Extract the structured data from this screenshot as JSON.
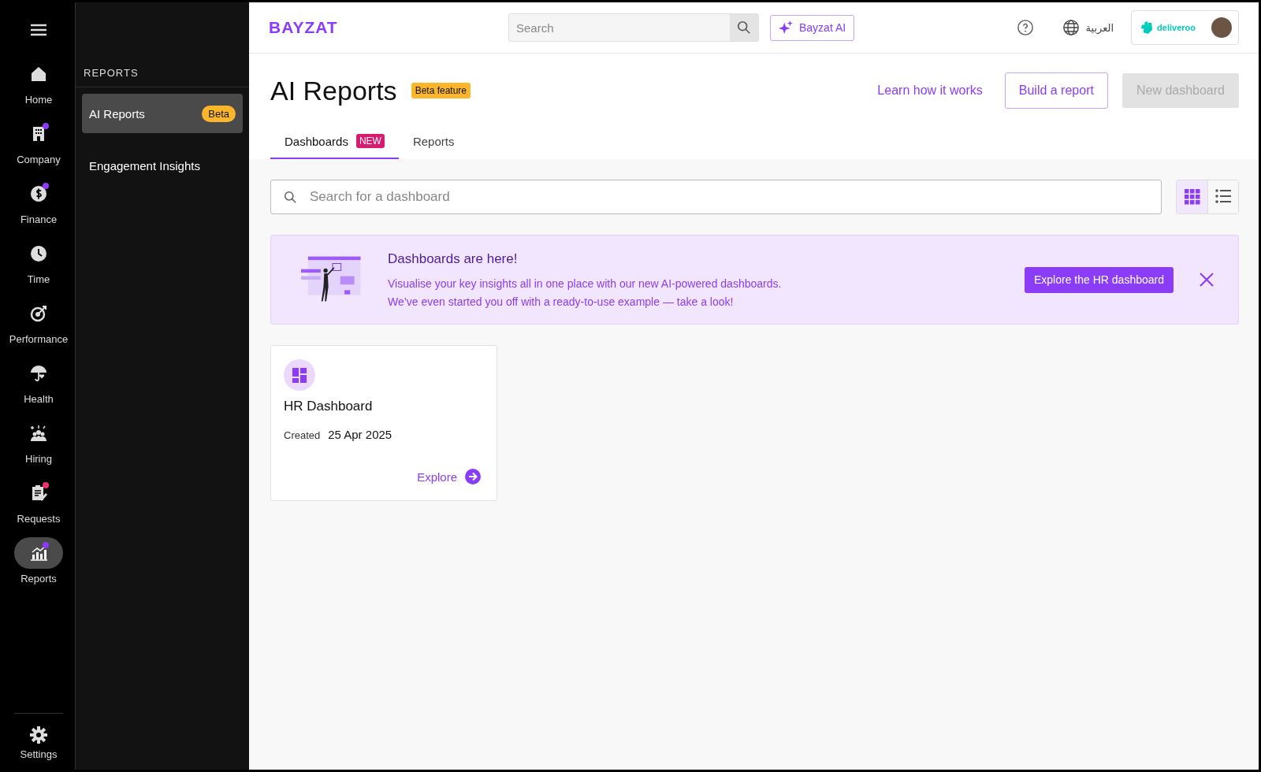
{
  "logo": "BAYZAT",
  "top_bar": {
    "search": {
      "placeholder": "Search"
    },
    "ai_button": "Bayzat AI",
    "language": "العربية",
    "company_logo": "deliveroo"
  },
  "nav_rail": {
    "items": [
      {
        "kind": "home",
        "label": "Home",
        "selected": false
      },
      {
        "kind": "company",
        "label": "Company",
        "selected": false,
        "color": "#8b3cf7"
      },
      {
        "kind": "finance",
        "label": "Finance",
        "selected": false,
        "color": "#8b3cf7"
      },
      {
        "kind": "time",
        "label": "Time",
        "selected": false
      },
      {
        "kind": "performance",
        "label": "Performance",
        "selected": false
      },
      {
        "kind": "health",
        "label": "Health",
        "selected": false
      },
      {
        "kind": "hiring",
        "label": "Hiring",
        "selected": false
      },
      {
        "kind": "requests",
        "label": "Requests",
        "selected": false,
        "color": "#e8336d"
      },
      {
        "kind": "reports",
        "label": "Reports",
        "selected": true,
        "color": "#8b3cf7"
      }
    ],
    "settings": "Settings"
  },
  "sub_nav": {
    "title": "REPORTS",
    "items": [
      {
        "label": "AI Reports",
        "badge": "Beta",
        "selected": true
      },
      {
        "label": "Engagement Insights",
        "selected": false
      }
    ]
  },
  "page": {
    "title": "AI Reports",
    "badge": "Beta feature",
    "learn_link": "Learn how it works",
    "build_button": "Build a report",
    "new_button": {
      "label": "New dashboard",
      "disabled": true
    }
  },
  "tabs": [
    {
      "label": "Dashboards",
      "badge": "NEW",
      "selected": true
    },
    {
      "label": "Reports",
      "selected": false
    }
  ],
  "search": {
    "placeholder": "Search for a dashboard"
  },
  "view_toggle": [
    {
      "kind": "grid",
      "selected": true
    },
    {
      "kind": "list",
      "selected": false
    }
  ],
  "banner": {
    "title": "Dashboards are here!",
    "lines": [
      "Visualise your key insights all in one place with our new AI-powered dashboards.",
      "We’ve even started you off with a ready-to-use example — take a look!"
    ],
    "button": "Explore the HR dashboard"
  },
  "cards": [
    {
      "title": "HR Dashboard",
      "created_label": "Created",
      "created_date": "25 Apr 2025",
      "link": "Explore"
    }
  ]
}
